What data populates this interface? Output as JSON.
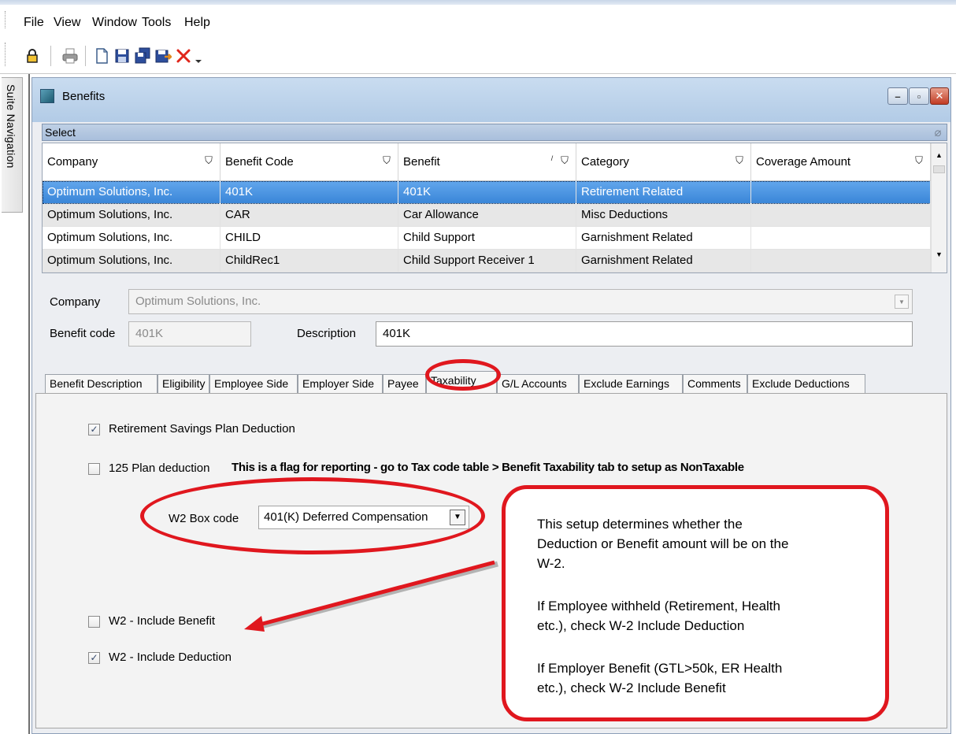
{
  "menu": {
    "items": [
      "File",
      "View",
      "Window",
      "Tools",
      "Help"
    ]
  },
  "toolbar": {
    "icons": [
      "lock-icon",
      "print-icon",
      "new-document-icon",
      "save-icon",
      "save-all-icon",
      "save-close-icon",
      "delete-icon",
      "dropdown-arrow-icon"
    ]
  },
  "suite_nav": {
    "label": "Suite Navigation"
  },
  "window": {
    "title": "Benefits",
    "select_label": "Select"
  },
  "grid": {
    "columns": [
      "Company",
      "Benefit Code",
      "Benefit",
      "Category",
      "Coverage Amount"
    ],
    "rows": [
      [
        "Optimum Solutions, Inc.",
        "401K",
        "401K",
        "Retirement Related",
        ""
      ],
      [
        "Optimum Solutions, Inc.",
        "CAR",
        "Car Allowance",
        "Misc Deductions",
        ""
      ],
      [
        "Optimum Solutions, Inc.",
        "CHILD",
        "Child Support",
        "Garnishment Related",
        ""
      ],
      [
        "Optimum Solutions, Inc.",
        "ChildRec1",
        "Child Support Receiver 1",
        "Garnishment Related",
        ""
      ]
    ],
    "selected_row": 0
  },
  "form": {
    "company_label": "Company",
    "company_value": "Optimum Solutions, Inc.",
    "benefit_code_label": "Benefit code",
    "benefit_code_value": "401K",
    "description_label": "Description",
    "description_value": "401K"
  },
  "tabs": [
    "Benefit Description",
    "Eligibility",
    "Employee Side",
    "Employer Side",
    "Payee",
    "Taxability",
    "G/L Accounts",
    "Exclude Earnings",
    "Comments",
    "Exclude Deductions"
  ],
  "active_tab": "Taxability",
  "taxability": {
    "retirement_label": "Retirement Savings Plan Deduction",
    "retirement_checked": true,
    "plan125_label": "125 Plan deduction",
    "plan125_checked": false,
    "plan125_note": "This is a flag for reporting - go to Tax code table > Benefit Taxability tab to setup as NonTaxable",
    "w2_box_label": "W2 Box code",
    "w2_box_value": "401(K) Deferred Compensation",
    "w2_include_benefit_label": "W2 - Include Benefit",
    "w2_include_benefit_checked": false,
    "w2_include_deduction_label": "W2 - Include Deduction",
    "w2_include_deduction_checked": true
  },
  "annotation": {
    "line1": "This setup determines whether the",
    "line2": "Deduction or Benefit amount will be on the",
    "line3": "W-2.",
    "line4": "If Employee withheld (Retirement, Health",
    "line5": "etc.), check W-2 Include Deduction",
    "line6": "If Employer Benefit (GTL>50k, ER Health",
    "line7": "etc.), check W-2 Include Benefit",
    "color": "#e0171e"
  }
}
